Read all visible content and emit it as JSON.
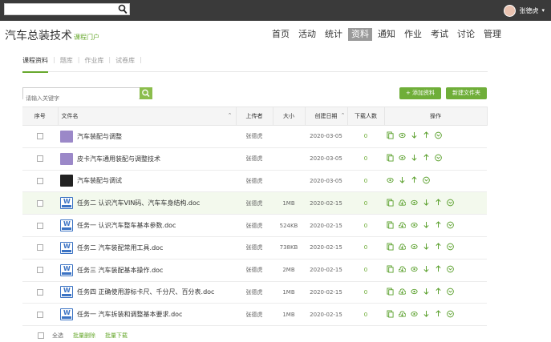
{
  "topbar": {
    "search_value": "",
    "user_name": "张德虎"
  },
  "header": {
    "course_title": "汽车总装技术",
    "course_subtitle": "课程门户",
    "nav": [
      "首页",
      "活动",
      "统计",
      "资料",
      "通知",
      "作业",
      "考试",
      "讨论",
      "管理"
    ],
    "nav_active": "资料"
  },
  "subtabs": {
    "items": [
      "课程资料",
      "题库",
      "作业库",
      "试卷库"
    ],
    "active": "课程资料"
  },
  "toolbar": {
    "search_placeholder": "请输入关键字",
    "add_material_label": "+ 添加资料",
    "new_folder_label": "新建文件夹"
  },
  "table": {
    "headers": [
      "序号",
      "文件名",
      "上传者",
      "大小",
      "创建日期",
      "下载人数",
      "操作"
    ],
    "rows": [
      {
        "icon": "url",
        "name": "汽车装配与调整",
        "uploader": "张德虎",
        "size": "",
        "date": "2020-03-05",
        "downloads": "0",
        "ops": [
          "share-icon",
          "view-icon",
          "move-down-icon",
          "move-up-icon",
          "more-icon"
        ]
      },
      {
        "icon": "url",
        "name": "皮卡汽车通用装配与调整技术",
        "uploader": "张德虎",
        "size": "",
        "date": "2020-03-05",
        "downloads": "0",
        "ops": [
          "share-icon",
          "view-icon",
          "move-down-icon",
          "move-up-icon",
          "more-icon"
        ]
      },
      {
        "icon": "img",
        "name": "汽车装配与调试",
        "uploader": "张德虎",
        "size": "",
        "date": "2020-03-05",
        "downloads": "0",
        "ops": [
          "view-icon",
          "move-down-icon",
          "move-up-icon",
          "more-icon"
        ]
      },
      {
        "icon": "word",
        "name": "任务二 认识汽车VIN码、汽车车身结构.doc",
        "uploader": "张德虎",
        "size": "1MB",
        "date": "2020-02-15",
        "downloads": "0",
        "ops": [
          "share-icon",
          "download-icon",
          "view-icon",
          "move-down-icon",
          "move-up-icon",
          "more-icon"
        ]
      },
      {
        "icon": "word",
        "name": "任务一 认识汽车整车基本参数.doc",
        "uploader": "张德虎",
        "size": "524KB",
        "date": "2020-02-15",
        "downloads": "0",
        "ops": [
          "share-icon",
          "download-icon",
          "view-icon",
          "move-down-icon",
          "move-up-icon",
          "more-icon"
        ]
      },
      {
        "icon": "word",
        "name": "任务二 汽车装配常用工具.doc",
        "uploader": "张德虎",
        "size": "738KB",
        "date": "2020-02-15",
        "downloads": "0",
        "ops": [
          "share-icon",
          "download-icon",
          "view-icon",
          "move-down-icon",
          "move-up-icon",
          "more-icon"
        ]
      },
      {
        "icon": "word",
        "name": "任务三 汽车装配基本操作.doc",
        "uploader": "张德虎",
        "size": "2MB",
        "date": "2020-02-15",
        "downloads": "0",
        "ops": [
          "share-icon",
          "download-icon",
          "view-icon",
          "move-down-icon",
          "move-up-icon",
          "more-icon"
        ]
      },
      {
        "icon": "word",
        "name": "任务四 正确使用游标卡尺、千分尺、百分表.doc",
        "uploader": "张德虎",
        "size": "1MB",
        "date": "2020-02-15",
        "downloads": "0",
        "ops": [
          "share-icon",
          "download-icon",
          "view-icon",
          "move-down-icon",
          "move-up-icon",
          "more-icon"
        ]
      },
      {
        "icon": "word",
        "name": "任务一 汽车拆装和调整基本要求.doc",
        "uploader": "张德虎",
        "size": "1MB",
        "date": "2020-02-15",
        "downloads": "0",
        "ops": [
          "share-icon",
          "download-icon",
          "view-icon",
          "move-down-icon",
          "move-up-icon",
          "more-icon"
        ]
      }
    ]
  },
  "footer": {
    "select_all_label": "全选",
    "batch_delete_label": "批量删除",
    "batch_download_label": "批量下载"
  },
  "colors": {
    "accent": "#67a82d",
    "button": "#6fae39",
    "topbar": "#3a3a3a",
    "highlight_row": "#f3f9ed"
  }
}
